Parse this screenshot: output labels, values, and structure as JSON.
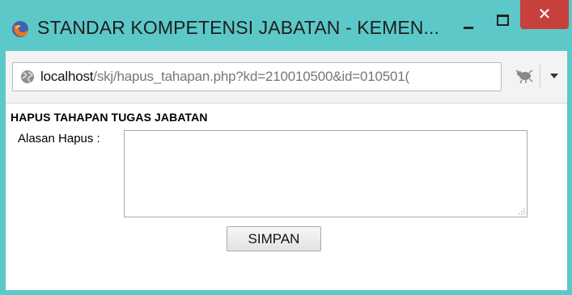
{
  "window": {
    "title": "STANDAR KOMPETENSI JABATAN - KEMEN...",
    "close_glyph": "✕"
  },
  "address_bar": {
    "host": "localhost",
    "path": "/skj/hapus_tahapan.php?kd=210010500&id=010501("
  },
  "icons": {
    "browser": "firefox-icon",
    "site": "globe-icon",
    "addon": "bug-icon",
    "menu": "chevron-down-icon"
  },
  "page": {
    "heading": "HAPUS TAHAPAN TUGAS JABATAN",
    "reason_label": "Alasan Hapus :",
    "reason_value": "",
    "submit_label": "SIMPAN"
  },
  "colors": {
    "titlebar": "#5cc8c8",
    "close_button": "#c7403b"
  }
}
